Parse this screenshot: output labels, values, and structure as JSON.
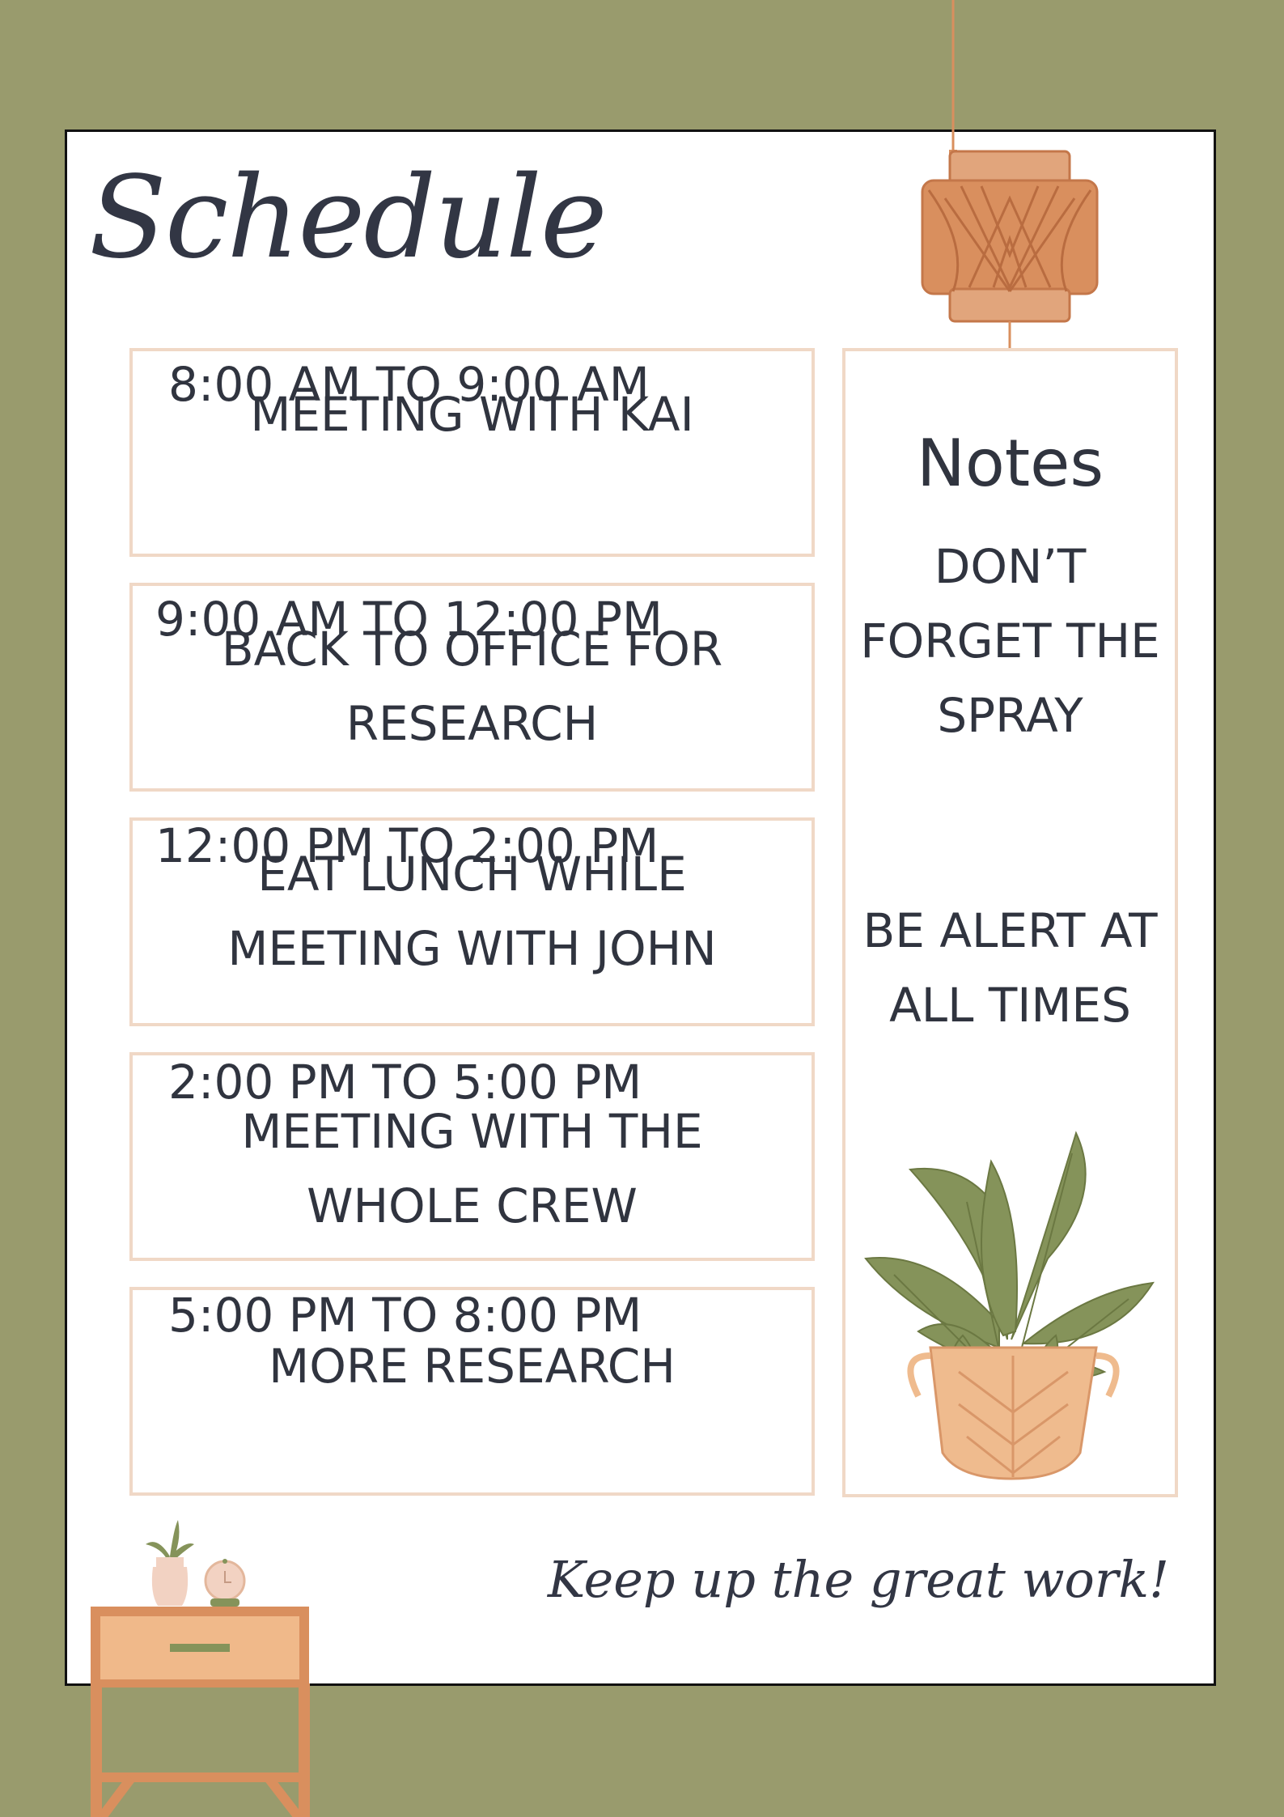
{
  "title": "Schedule",
  "schedule": [
    {
      "time": "8:00 AM TO 9:00 AM",
      "task": "MEETING WITH KAI"
    },
    {
      "time": "9:00 AM TO 12:00 PM",
      "task": "BACK TO OFFICE FOR\nRESEARCH"
    },
    {
      "time": "12:00 PM TO 2:00 PM",
      "task": "EAT LUNCH WHILE\nMEETING WITH JOHN"
    },
    {
      "time": "2:00 PM TO 5:00 PM",
      "task": "MEETING WITH THE\nWHOLE CREW"
    },
    {
      "time": "5:00 PM TO 8:00 PM",
      "task": "MORE RESEARCH"
    }
  ],
  "notes": {
    "title": "Notes",
    "items": [
      "DON’T\nFORGET THE\nSPRAY",
      "BE ALERT AT\nALL TIMES"
    ]
  },
  "footer": "Keep up the great work!",
  "colors": {
    "background": "#999b6d",
    "paper": "#ffffff",
    "box_border": "#f0d8c6",
    "text": "#30343f",
    "terracotta": "#d98f5e",
    "leaf": "#85935a"
  },
  "decorations": [
    "hanging-lamp-icon",
    "potted-plant-icon",
    "nightstand-icon",
    "small-vase-icon",
    "clock-icon"
  ]
}
